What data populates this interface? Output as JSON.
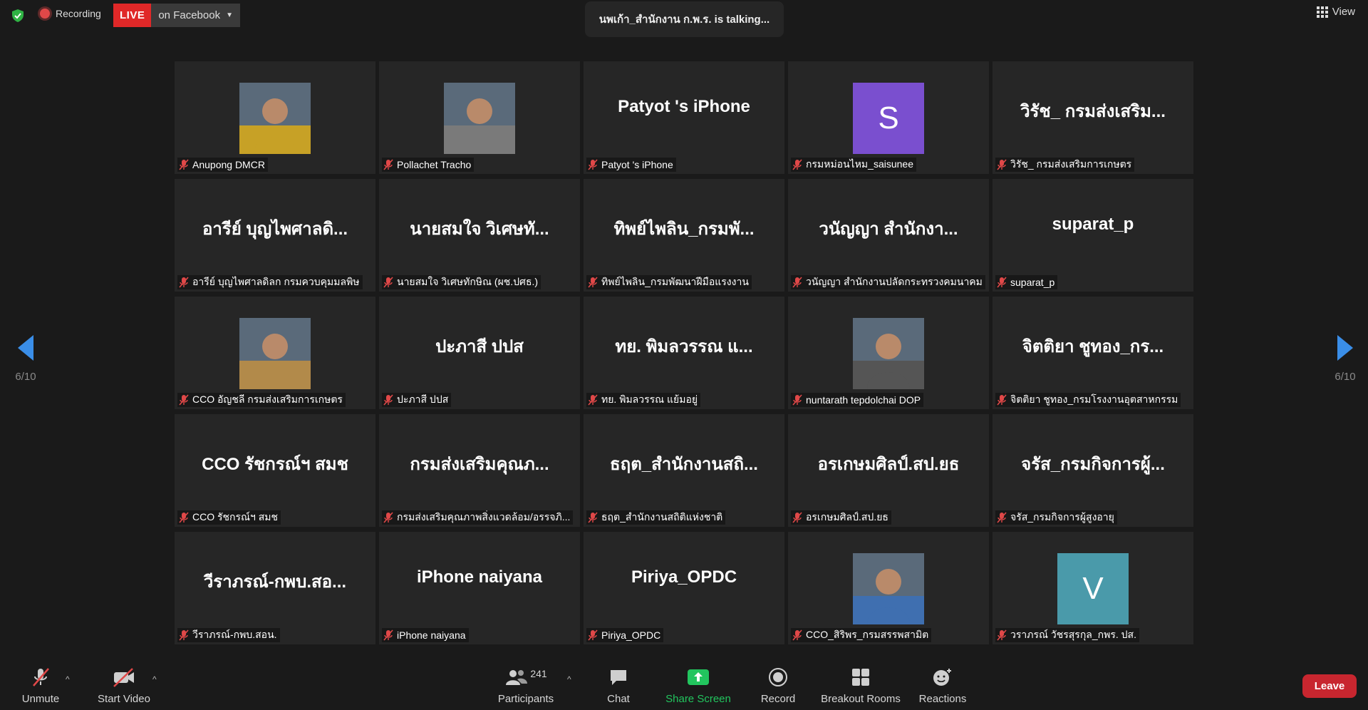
{
  "topbar": {
    "recording": "Recording",
    "live": "LIVE",
    "live_target": "on Facebook",
    "talking": "นพเก้า_สำนักงาน ก.พ.ร. is talking...",
    "view": "View"
  },
  "pager": {
    "left": "6/10",
    "right": "6/10"
  },
  "tiles": [
    {
      "name": "Anupong DMCR",
      "kind": "photo",
      "photo_color": "#c7a126"
    },
    {
      "name": "Pollachet Tracho",
      "kind": "photo",
      "photo_color": "#7a7a7a"
    },
    {
      "name": "Patyot 's iPhone",
      "kind": "text",
      "big": "Patyot 's iPhone"
    },
    {
      "name": "กรมหม่อนไหม_saisunee",
      "kind": "avatar",
      "letter": "S",
      "color": "#7a4fcf"
    },
    {
      "name": "วิรัช_ กรมส่งเสริมการเกษตร",
      "kind": "text",
      "big": "วิรัช_ กรมส่งเสริม..."
    },
    {
      "name": "อารีย์ บุญไพศาลดิลก กรมควบคุมมลพิษ",
      "kind": "text",
      "big": "อารีย์ บุญไพศาลดิ..."
    },
    {
      "name": "นายสมใจ วิเศษทักษิณ (ผช.ปศธ.)",
      "kind": "text",
      "big": "นายสมใจ วิเศษทั..."
    },
    {
      "name": "ทิพย์ไพลิน_กรมพัฒนาฝีมือแรงงาน",
      "kind": "text",
      "big": "ทิพย์ไพลิน_กรมพั..."
    },
    {
      "name": "วนัญญา สำนักงานปลัดกระทรวงคมนาคม",
      "kind": "text",
      "big": "วนัญญา สำนักงา..."
    },
    {
      "name": "suparat_p",
      "kind": "text",
      "big": "suparat_p"
    },
    {
      "name": "CCO อัญชลี กรมส่งเสริมการเกษตร",
      "kind": "photo",
      "photo_color": "#b28a4a"
    },
    {
      "name": "ปะภาสี ปปส",
      "kind": "text",
      "big": "ปะภาสี ปปส"
    },
    {
      "name": "ทย. พิมลวรรณ แย้มอยู่",
      "kind": "text",
      "big": "ทย. พิมลวรรณ แ..."
    },
    {
      "name": "nuntarath tepdolchai DOP",
      "kind": "photo",
      "photo_color": "#555555"
    },
    {
      "name": "จิตติยา ชูทอง_กรมโรงงานอุตสาหกรรม",
      "kind": "text",
      "big": "จิตติยา ชูทอง_กร..."
    },
    {
      "name": "CCO รัชกรณ์ฯ สมช",
      "kind": "text",
      "big": "CCO รัชกรณ์ฯ สมช"
    },
    {
      "name": "กรมส่งเสริมคุณภาพสิ่งแวดล้อม/อรรจภิ...",
      "kind": "text",
      "big": "กรมส่งเสริมคุณภ..."
    },
    {
      "name": "ธฤต_สำนักงานสถิติแห่งชาติ",
      "kind": "text",
      "big": "ธฤต_สำนักงานสถิ..."
    },
    {
      "name": "อรเกษมศิลป์.สป.ยธ",
      "kind": "text",
      "big": "อรเกษมศิลป์.สป.ยธ"
    },
    {
      "name": "จรัส_กรมกิจการผู้สูงอายุ",
      "kind": "text",
      "big": "จรัส_กรมกิจการผู้..."
    },
    {
      "name": "วีราภรณ์-กพบ.สอน.",
      "kind": "text",
      "big": "วีราภรณ์-กพบ.สอ..."
    },
    {
      "name": "iPhone naiyana",
      "kind": "text",
      "big": "iPhone naiyana"
    },
    {
      "name": "Piriya_OPDC",
      "kind": "text",
      "big": "Piriya_OPDC"
    },
    {
      "name": "CCO_สิริพร_กรมสรรพสามิต",
      "kind": "photo",
      "photo_color": "#3f6fb0"
    },
    {
      "name": "วราภรณ์ วัชรสุรกุล_กพร. ปส.",
      "kind": "avatar",
      "letter": "V",
      "color": "#4a9aaa"
    }
  ],
  "toolbar": {
    "unmute": "Unmute",
    "start_video": "Start Video",
    "participants": "Participants",
    "participants_count": "241",
    "chat": "Chat",
    "share_screen": "Share Screen",
    "record": "Record",
    "breakout_rooms": "Breakout Rooms",
    "reactions": "Reactions",
    "leave": "Leave"
  },
  "colors": {
    "accent_blue": "#3a8ee8",
    "share_green": "#22c55e",
    "leave_red": "#c8262f",
    "live_red": "#e02828"
  }
}
